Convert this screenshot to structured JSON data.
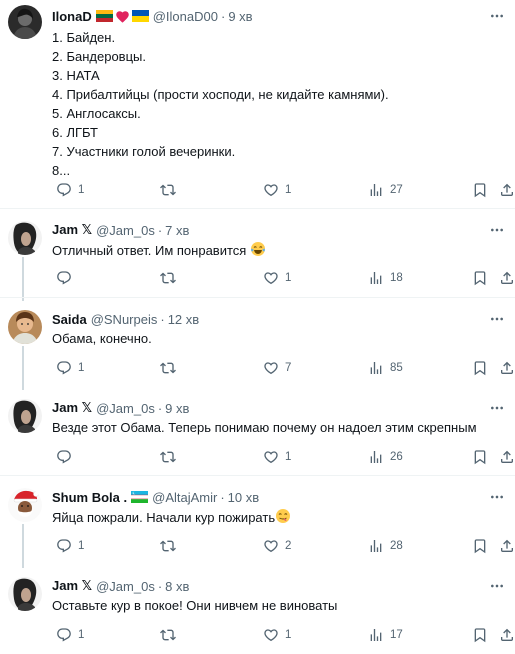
{
  "tweets": [
    {
      "name": "IlonaD",
      "handle": "@IlonaD00",
      "time": "9 хв",
      "lines": [
        "1. Байден.",
        "2. Бандеровцы.",
        "3. НАТА",
        "4. Прибалтийцы (прости хосподи, не кидайте камнями).",
        "5. Англосаксы.",
        "6. ЛГБТ",
        "7. Участники голой вечеринки.",
        "8..."
      ],
      "replies": "1",
      "reposts": "",
      "likes": "1",
      "views": "27"
    },
    {
      "name": "Jam 𝕏",
      "handle": "@Jam_0s",
      "time": "7 хв",
      "text": "Отличный ответ. Им понравится",
      "replies": "",
      "reposts": "",
      "likes": "1",
      "views": "18"
    },
    {
      "name": "Saida",
      "handle": "@SNurpeis",
      "time": "12 хв",
      "text": "Обама, конечно.",
      "replies": "1",
      "reposts": "",
      "likes": "7",
      "views": "85"
    },
    {
      "name": "Jam 𝕏",
      "handle": "@Jam_0s",
      "time": "9 хв",
      "text": "Везде этот Обама. Теперь понимаю почему он надоел этим скрепным",
      "replies": "",
      "reposts": "",
      "likes": "1",
      "views": "26"
    },
    {
      "name": "Shum Bola .",
      "handle": "@AltajAmir",
      "time": "10 хв",
      "text": "Яйца пожрали. Начали кур пожирать",
      "replies": "1",
      "reposts": "",
      "likes": "2",
      "views": "28"
    },
    {
      "name": "Jam 𝕏",
      "handle": "@Jam_0s",
      "time": "8 хв",
      "text": "Оставьте кур в покое! Они нивчем не виноваты",
      "replies": "1",
      "reposts": "",
      "likes": "1",
      "views": "17"
    }
  ],
  "icons": {
    "reply": "reply-icon",
    "repost": "repost-icon",
    "like": "heart-icon",
    "views": "views-icon",
    "bookmark": "bookmark-icon",
    "share": "share-icon",
    "more": "more-icon"
  },
  "colors": {
    "text_primary": "#0f1419",
    "text_secondary": "#536471",
    "divider": "#eff3f4",
    "thread_line": "#cfd9de"
  }
}
